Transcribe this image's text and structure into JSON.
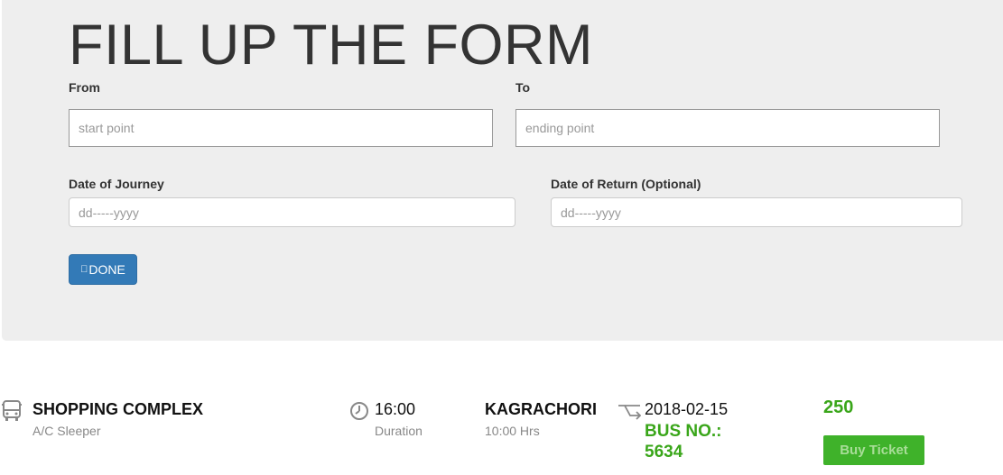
{
  "form": {
    "title": "FILL UP THE FORM",
    "from_label": "From",
    "from_placeholder": "start point",
    "to_label": "To",
    "to_placeholder": "ending point",
    "date_journey_label": "Date of Journey",
    "date_journey_placeholder": "dd-----yyyy",
    "date_return_label": "Date of Return (Optional)",
    "date_return_placeholder": "dd-----yyyy",
    "done_icon": "",
    "done_label": "DONE"
  },
  "result": {
    "bus_icon": "bus-icon",
    "origin": "SHOPPING COMPLEX",
    "bus_type": "A/C Sleeper",
    "clock_icon": "clock-icon",
    "departure_time": "16:00",
    "duration_label": "Duration",
    "destination": "KAGRACHORI",
    "duration_value": "10:00 Hrs",
    "route_icon": "route-icon",
    "date": "2018-02-15",
    "bus_no_label": "BUS NO.:",
    "bus_no": "5634",
    "price": "250",
    "buy_label": "Buy Ticket"
  }
}
